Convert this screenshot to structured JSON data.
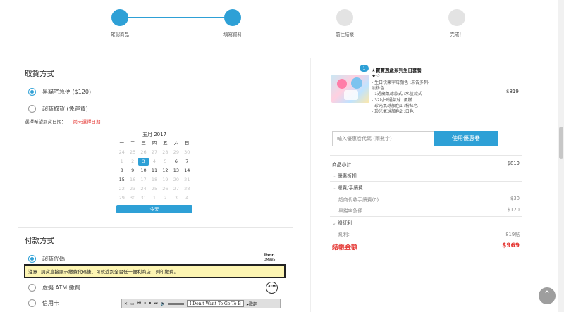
{
  "stepper": {
    "steps": [
      {
        "label": "確認商品",
        "status": "done"
      },
      {
        "label": "填寫資料",
        "status": "done"
      },
      {
        "label": "前往結帳",
        "status": "pending"
      },
      {
        "label": "完成！",
        "status": "pending"
      }
    ]
  },
  "pickup": {
    "title": "取貨方式",
    "options": [
      {
        "label": "黑貓宅急便 ($120)",
        "checked": true
      },
      {
        "label": "超商取貨 (免運費)",
        "checked": false
      }
    ],
    "date_label": "選擇希望到貨日期：",
    "date_warning": "尚未選擇日期"
  },
  "calendar": {
    "title": "五月 2017",
    "weekdays": [
      "一",
      "二",
      "三",
      "四",
      "五",
      "六",
      "日"
    ],
    "days": [
      {
        "d": "24",
        "muted": true
      },
      {
        "d": "25",
        "muted": true
      },
      {
        "d": "26",
        "muted": true
      },
      {
        "d": "27",
        "muted": true
      },
      {
        "d": "28",
        "muted": true
      },
      {
        "d": "29",
        "muted": true
      },
      {
        "d": "30",
        "muted": true
      },
      {
        "d": "1",
        "muted": true
      },
      {
        "d": "2",
        "muted": true
      },
      {
        "d": "3",
        "today": true
      },
      {
        "d": "4",
        "muted": true
      },
      {
        "d": "5",
        "muted": true
      },
      {
        "d": "6"
      },
      {
        "d": "7"
      },
      {
        "d": "8"
      },
      {
        "d": "9"
      },
      {
        "d": "10"
      },
      {
        "d": "11"
      },
      {
        "d": "12"
      },
      {
        "d": "13"
      },
      {
        "d": "14"
      },
      {
        "d": "15"
      },
      {
        "d": "16",
        "muted": true
      },
      {
        "d": "17",
        "muted": true
      },
      {
        "d": "18",
        "muted": true
      },
      {
        "d": "19",
        "muted": true
      },
      {
        "d": "20",
        "muted": true
      },
      {
        "d": "21",
        "muted": true
      },
      {
        "d": "22",
        "muted": true
      },
      {
        "d": "23",
        "muted": true
      },
      {
        "d": "24",
        "muted": true
      },
      {
        "d": "25",
        "muted": true
      },
      {
        "d": "26",
        "muted": true
      },
      {
        "d": "27",
        "muted": true
      },
      {
        "d": "28",
        "muted": true
      },
      {
        "d": "29",
        "muted": true
      },
      {
        "d": "30",
        "muted": true
      },
      {
        "d": "31",
        "muted": true
      },
      {
        "d": "1",
        "muted": true
      },
      {
        "d": "2",
        "muted": true
      },
      {
        "d": "3",
        "muted": true
      },
      {
        "d": "4",
        "muted": true
      }
    ],
    "today_button": "今天"
  },
  "payment": {
    "title": "付款方式",
    "options": [
      {
        "label": "超商代碼",
        "checked": true
      },
      {
        "label": "虛擬 ATM 繳費",
        "checked": false
      },
      {
        "label": "信用卡",
        "checked": false
      }
    ],
    "notice_prefix": "注意",
    "notice_text": "調貨直接顯示繳費代碼後，可就近到全台任一便利商店，列印繳費。",
    "ibon_label": "ibon",
    "ibon_sub": "QMBBS",
    "atm_label": "ATM"
  },
  "cart": {
    "qty": "1",
    "item_name": "★寶寶週歲系列生日套餐",
    "item_stars": "★☆",
    "item_options": [
      "- 生日快樂字母顏色 :未告多列-",
      "  淡粉色",
      "- 1週歲氣球款式 :水藍款式",
      "- 32吋卡通氣球 :蛋糕",
      "- 珍光氣球顏色1 :粉紅色",
      "- 珍光氣球顏色2 :白色"
    ],
    "item_price": "$819",
    "coupon_placeholder": "輸入優惠卷代碼 (兩數字)",
    "coupon_button": "使用優惠卷"
  },
  "summary": {
    "subtotal_label": "商品小計",
    "subtotal_value": "$819",
    "discount_label": "優惠折扣",
    "shipping_label": "運費/手續費",
    "shipping_rows": [
      {
        "label": "超商代收手續費(0)",
        "value": "$30"
      },
      {
        "label": "黑貓宅急便",
        "value": "$120"
      }
    ],
    "bonus_label": "贈紅利",
    "bonus_row": {
      "label": "紅利:",
      "value": "819點"
    },
    "total_label": "結帳金額",
    "total_value": "$969"
  },
  "media": {
    "track": "I Don't Want To Go To B",
    "menu": "▸歌詞"
  }
}
